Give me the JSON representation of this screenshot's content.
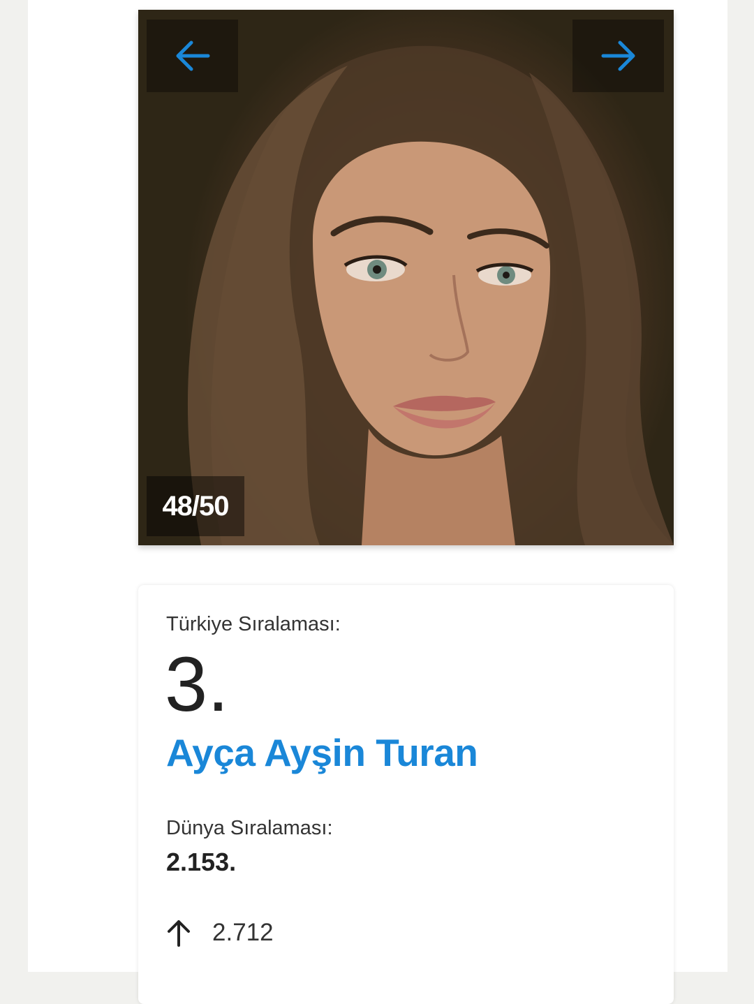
{
  "gallery": {
    "counter": "48/50",
    "prev_icon": "arrow-left-icon",
    "next_icon": "arrow-right-icon",
    "accent_color": "#1a87d8"
  },
  "ranking": {
    "turkey_label": "Türkiye Sıralaması:",
    "turkey_rank": "3.",
    "name": "Ayça Ayşin Turan",
    "world_label": "Dünya Sıralaması:",
    "world_rank": "2.153.",
    "trend_icon": "arrow-up-icon",
    "trend_value": "2.712"
  }
}
